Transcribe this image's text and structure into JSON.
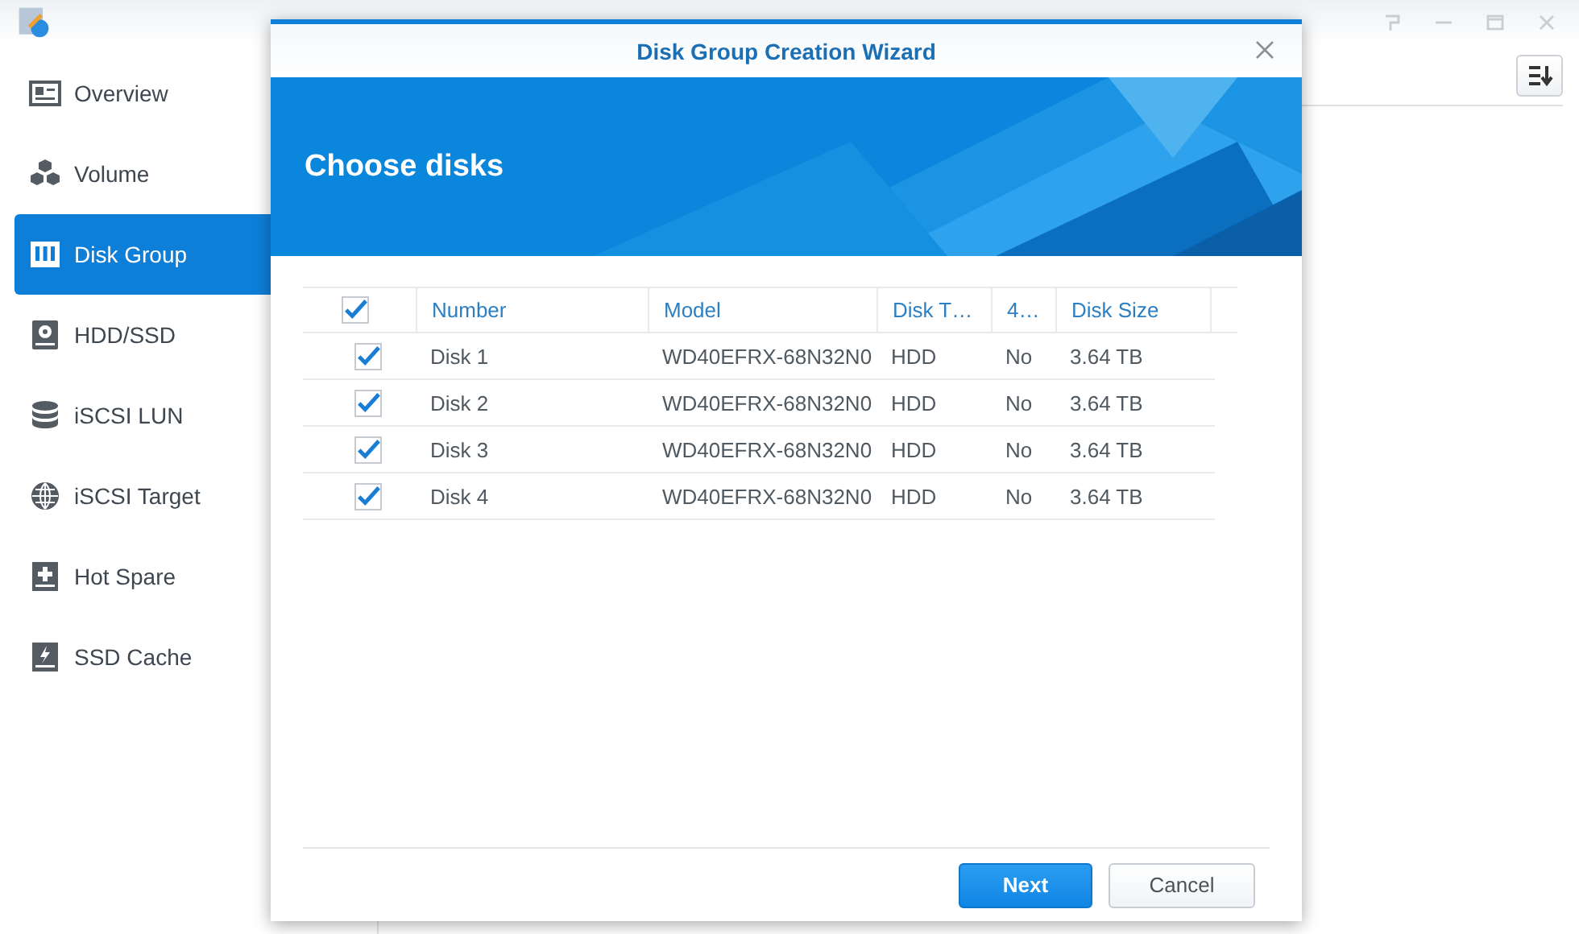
{
  "sidebar": {
    "items": [
      {
        "label": "Overview",
        "kind": "overview",
        "selected": false
      },
      {
        "label": "Volume",
        "kind": "volume",
        "selected": false
      },
      {
        "label": "Disk Group",
        "kind": "diskgroup",
        "selected": true
      },
      {
        "label": "HDD/SSD",
        "kind": "hdd",
        "selected": false
      },
      {
        "label": "iSCSI LUN",
        "kind": "lun",
        "selected": false
      },
      {
        "label": "iSCSI Target",
        "kind": "target",
        "selected": false
      },
      {
        "label": "Hot Spare",
        "kind": "spare",
        "selected": false
      },
      {
        "label": "SSD Cache",
        "kind": "cache",
        "selected": false
      }
    ]
  },
  "dialog": {
    "title": "Disk Group Creation Wizard",
    "heading": "Choose disks",
    "table": {
      "select_all_checked": true,
      "columns": [
        "Number",
        "Model",
        "Disk T…",
        "4…",
        "Disk Size"
      ],
      "rows": [
        {
          "checked": true,
          "cells": [
            "Disk 1",
            "WD40EFRX-68N32N0",
            "HDD",
            "No",
            "3.64 TB"
          ]
        },
        {
          "checked": true,
          "cells": [
            "Disk 2",
            "WD40EFRX-68N32N0",
            "HDD",
            "No",
            "3.64 TB"
          ]
        },
        {
          "checked": true,
          "cells": [
            "Disk 3",
            "WD40EFRX-68N32N0",
            "HDD",
            "No",
            "3.64 TB"
          ]
        },
        {
          "checked": true,
          "cells": [
            "Disk 4",
            "WD40EFRX-68N32N0",
            "HDD",
            "No",
            "3.64 TB"
          ]
        }
      ]
    },
    "buttons": [
      {
        "label": "Next",
        "kind": "primary"
      },
      {
        "label": "Cancel",
        "kind": "secondary"
      }
    ]
  }
}
